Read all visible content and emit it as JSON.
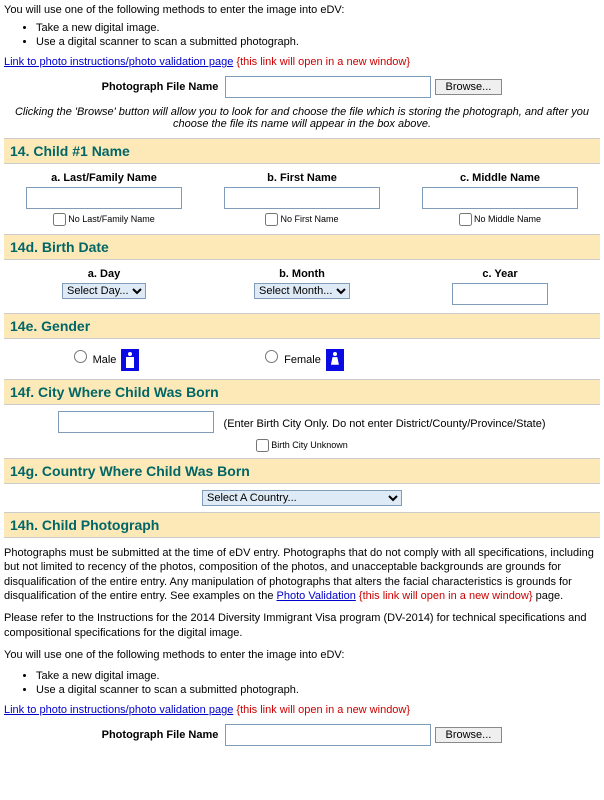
{
  "intro": "You will use one of the following methods to enter the image into eDV:",
  "methods": [
    "Take a new digital image.",
    "Use a digital scanner to scan a submitted photograph."
  ],
  "photo_link_text": "Link to photo instructions/photo validation page",
  "new_window_note": "{this link will open in a new window}",
  "photo_file_label": "Photograph File Name",
  "browse_label": "Browse...",
  "browse_help": "Clicking the 'Browse' button will allow you to look for and choose the file which is storing the photograph, and after you choose the file its name will appear in the box above.",
  "sec14": {
    "title": "14. Child #1 Name",
    "cols": {
      "last_label": "a. Last/Family Name",
      "first_label": "b. First Name",
      "middle_label": "c. Middle Name",
      "no_last": "No Last/Family Name",
      "no_first": "No First Name",
      "no_middle": "No Middle Name"
    }
  },
  "sec14d": {
    "title": "14d. Birth Date",
    "day_label": "a. Day",
    "month_label": "b. Month",
    "year_label": "c. Year",
    "day_ph": "Select Day...",
    "month_ph": "Select Month..."
  },
  "sec14e": {
    "title": "14e. Gender",
    "male": "Male",
    "female": "Female"
  },
  "sec14f": {
    "title": "14f. City Where Child Was Born",
    "hint": "(Enter Birth City Only. Do not enter District/County/Province/State)",
    "unknown": "Birth City Unknown"
  },
  "sec14g": {
    "title": "14g. Country Where Child Was Born",
    "ph": "Select A Country..."
  },
  "sec14h": {
    "title": "14h. Child Photograph",
    "p1": "Photographs must be submitted at the time of eDV entry. Photographs that do not comply with all specifications, including but not limited to recency of the photos, composition of the photos, and unacceptable backgrounds are grounds for disqualification of the entire entry. Any manipulation of photographs that alters the facial characteristics is grounds for disqualification of the entire entry. See examples on the ",
    "photo_validation_link": "Photo Validation",
    "p1_end": " page.",
    "p2": "Please refer to the Instructions for the 2014 Diversity Immigrant Visa program (DV-2014) for technical specifications and compositional specifications for the digital image."
  }
}
